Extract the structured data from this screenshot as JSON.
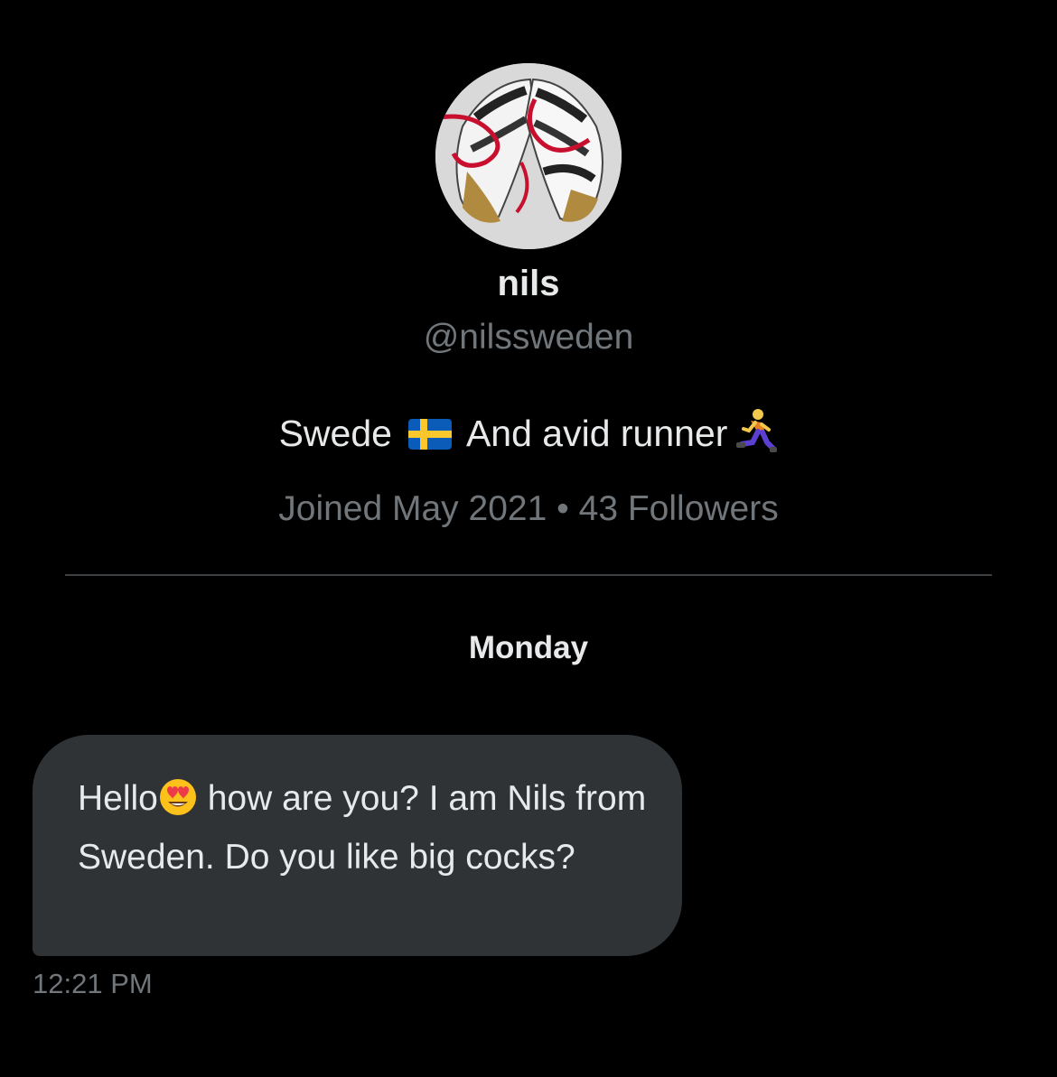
{
  "profile": {
    "avatar_alt": "avatar",
    "display_name": "nils",
    "handle": "@nilssweden",
    "bio_part1": "Swede",
    "bio_flag_icon": "sweden-flag-icon",
    "bio_part2": "And avid runner",
    "bio_runner_icon": "runner-icon",
    "joined": "Joined May 2021",
    "separator": "•",
    "followers": "43 Followers"
  },
  "conversation": {
    "day_label": "Monday",
    "messages": [
      {
        "text_before_emoji": "Hello",
        "emoji_icon": "heart-eyes-emoji-icon",
        "text_after_emoji": "how are you? I am Nils from Sweden. Do you like big cocks?",
        "time": "12:21 PM"
      }
    ]
  },
  "colors": {
    "background": "#000000",
    "primary_text": "#e7e9ea",
    "secondary_text": "#71767b",
    "bubble": "#2f3336",
    "divider": "#3e4144"
  }
}
